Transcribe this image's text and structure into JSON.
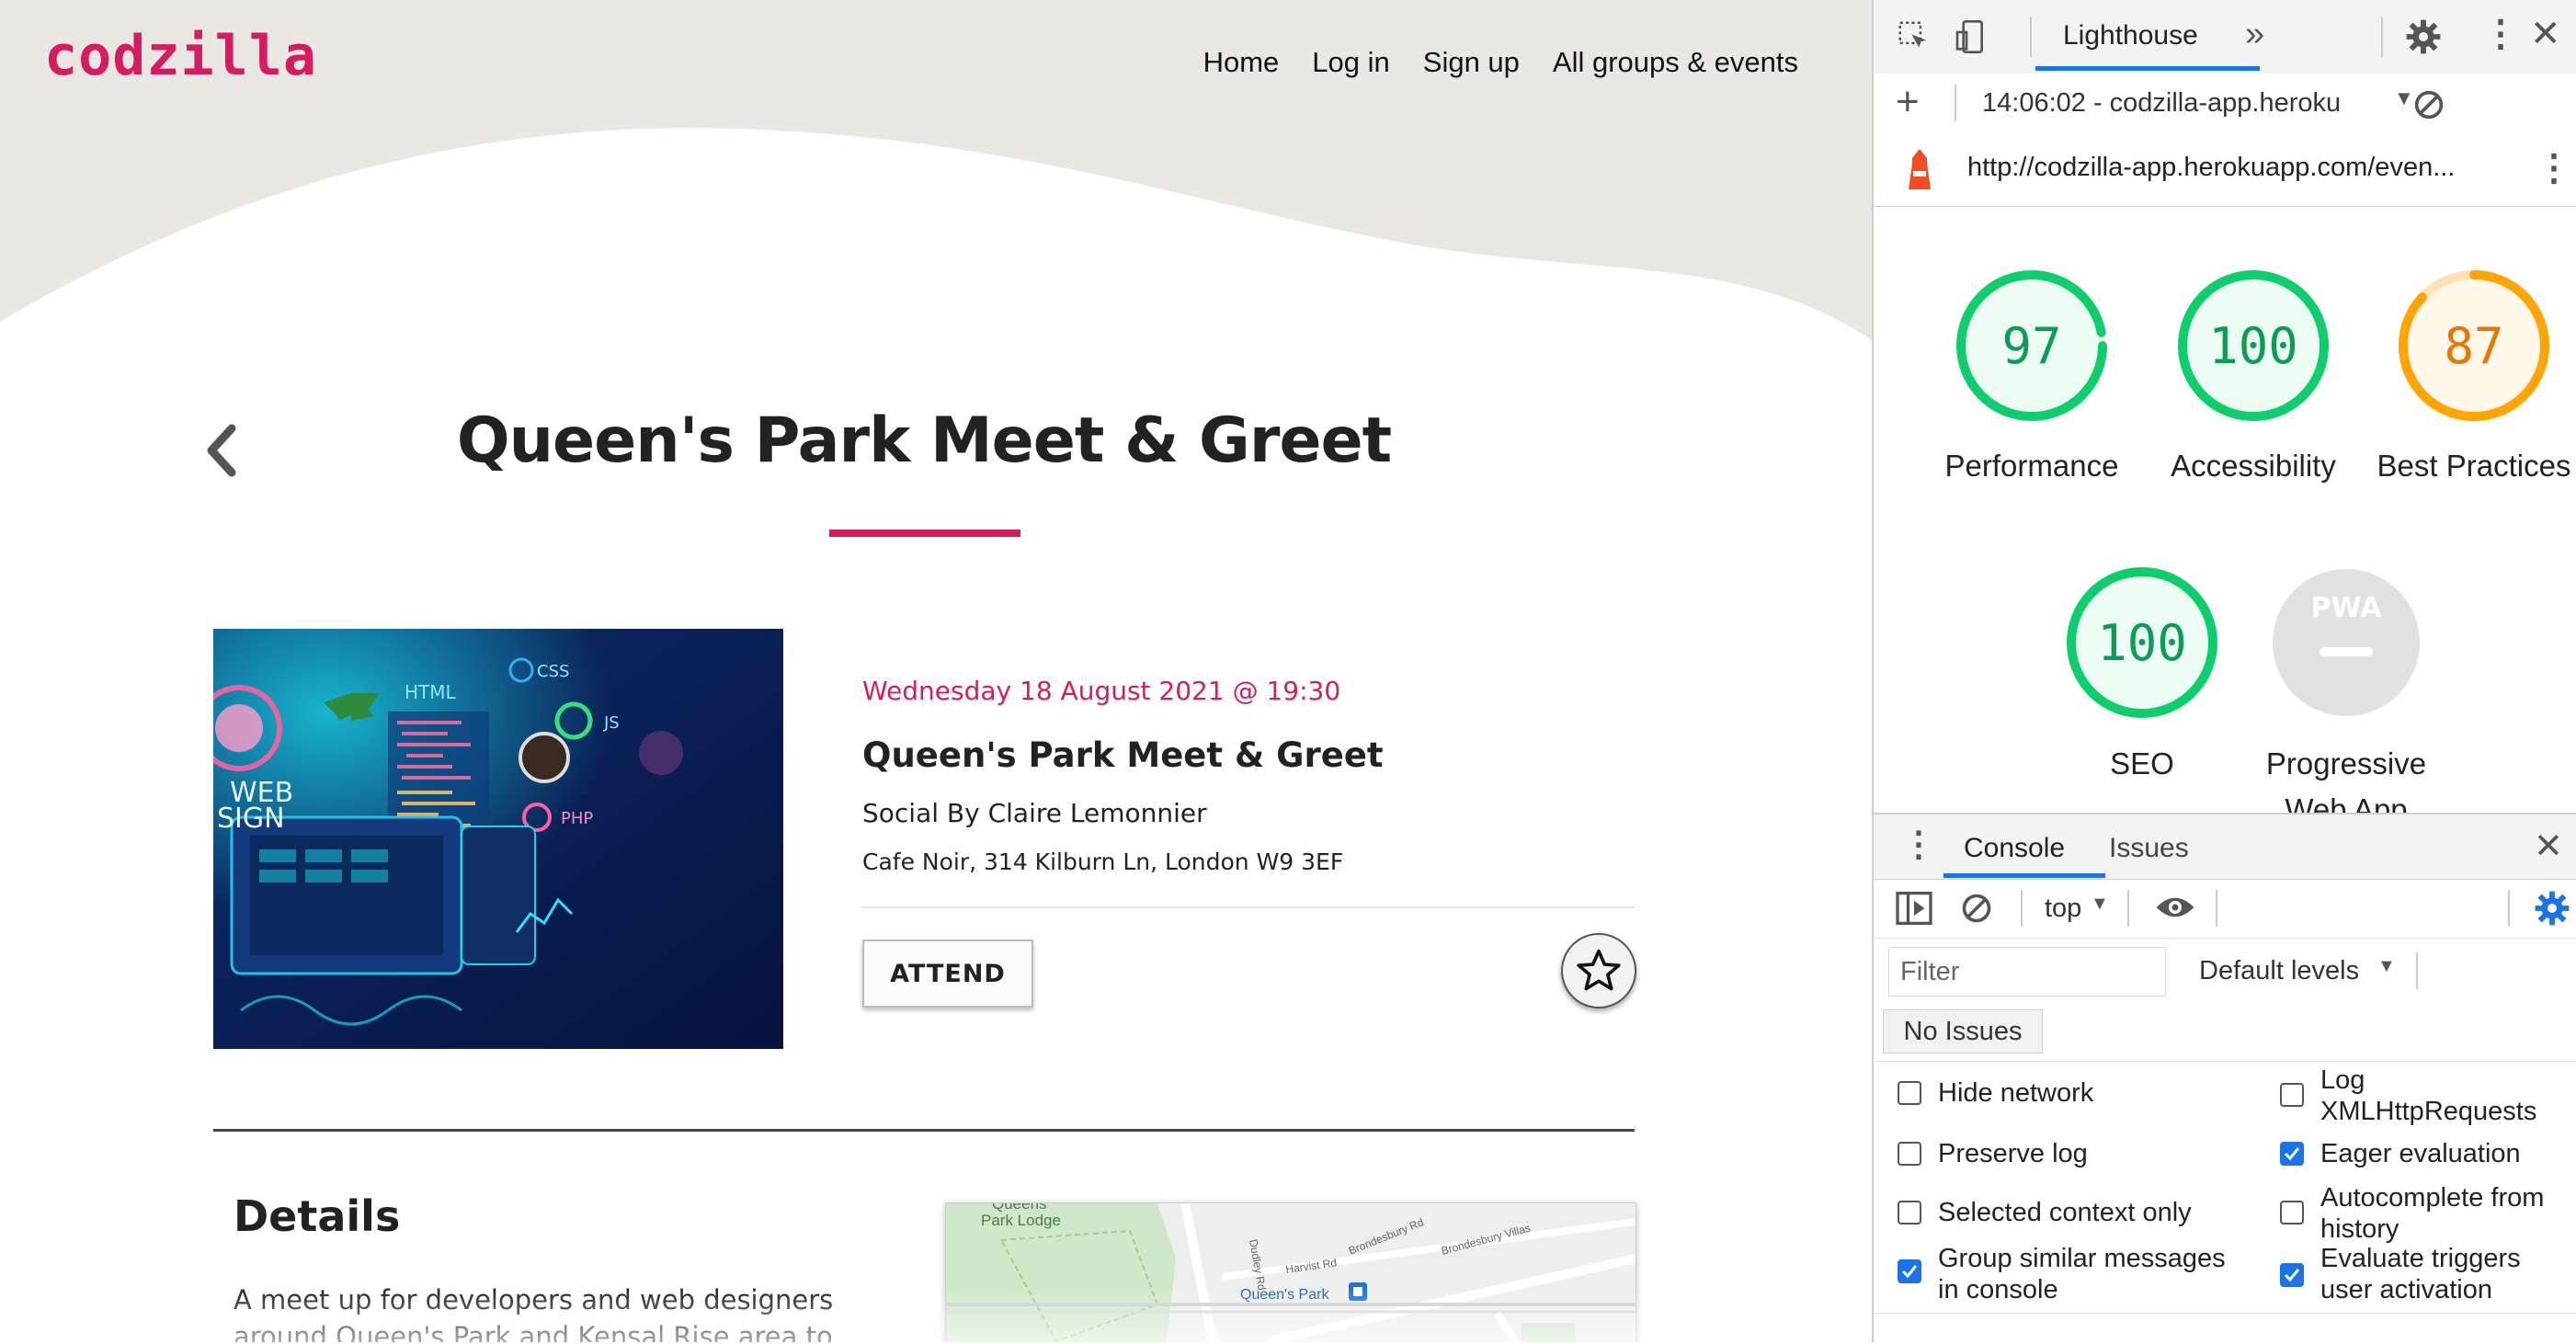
{
  "site": {
    "logo": "codzilla",
    "nav": [
      "Home",
      "Log in",
      "Sign up",
      "All groups & events"
    ]
  },
  "event": {
    "page_title": "Queen's Park Meet & Greet",
    "datetime": "Wednesday 18 August 2021 @ 19:30",
    "name": "Queen's Park Meet & Greet",
    "organiser": "Social By Claire Lemonnier",
    "address": "Cafe Noir, 314 Kilburn Ln, London W9 3EF",
    "attend_label": "ATTEND",
    "image_labels": [
      "HTML",
      "CSS",
      "JS",
      "PHP",
      "WEB",
      "SIGN"
    ]
  },
  "details": {
    "heading": "Details",
    "text": "A meet up for developers and web designers around Queen's Park and Kensal Rise area to meet, socialise"
  },
  "map": {
    "labels": [
      "Queens",
      "Park Lodge",
      "Queen's Park",
      "Dudley Rd",
      "Harvist Rd",
      "Brondesbury Rd",
      "Brondesbury Villas"
    ]
  },
  "devtools": {
    "active_tab": "Lighthouse",
    "report": "14:06:02 - codzilla-app.heroku",
    "url": "http://codzilla-app.herokuapp.com/even...",
    "scores": [
      {
        "label": "Performance",
        "value": "97",
        "score": 97,
        "color": "#0cce6b"
      },
      {
        "label": "Accessibility",
        "value": "100",
        "score": 100,
        "color": "#0cce6b"
      },
      {
        "label": "Best Practices",
        "value": "87",
        "score": 87,
        "color": "#ffa400"
      },
      {
        "label": "SEO",
        "value": "100",
        "score": 100,
        "color": "#0cce6b"
      }
    ],
    "pwa": {
      "badge": "PWA",
      "label": "Progressive Web App"
    },
    "console": {
      "tabs": [
        "Console",
        "Issues"
      ],
      "context": "top",
      "filter_placeholder": "Filter",
      "levels": "Default levels",
      "issues_button": "No Issues",
      "options_left": [
        {
          "label": "Hide network",
          "checked": false
        },
        {
          "label": "Preserve log",
          "checked": false
        },
        {
          "label": "Selected context only",
          "checked": false
        },
        {
          "label": "Group similar messages in console",
          "checked": true
        }
      ],
      "options_right": [
        {
          "label": "Log XMLHttpRequests",
          "checked": false
        },
        {
          "label": "Eager evaluation",
          "checked": true
        },
        {
          "label": "Autocomplete from history",
          "checked": false
        },
        {
          "label": "Evaluate triggers user activation",
          "checked": true
        }
      ]
    }
  },
  "colors": {
    "brand": "#d81b60",
    "pass": "#0cce6b",
    "average": "#ffa400",
    "devtools_blue": "#1a73e8"
  }
}
